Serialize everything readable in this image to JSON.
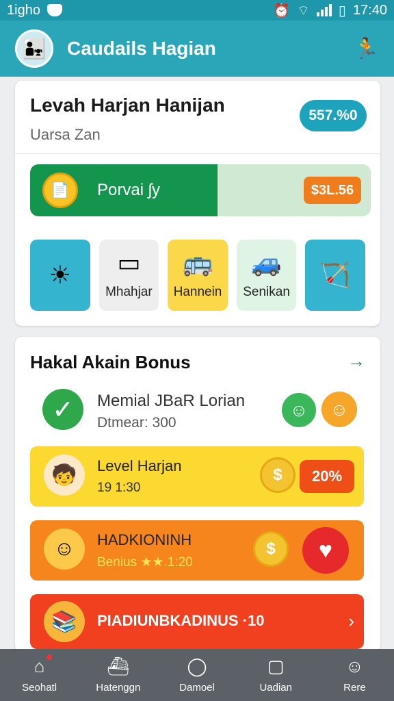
{
  "status": {
    "carrier": "1igho",
    "time": "17:40"
  },
  "header": {
    "title": "Caudails Hagian"
  },
  "level": {
    "title": "Levah Harjan Hanijan",
    "subtitle": "Uarsa Zan",
    "pill": "557.%0"
  },
  "progress": {
    "label": "Porvai ʃy",
    "price": "$3L.56",
    "fill_fraction": 0.55
  },
  "tiles": [
    {
      "icon": "sun-icon",
      "label": "",
      "bg": "#35b4cf"
    },
    {
      "icon": "tablet-icon",
      "label": "Mhahjar",
      "bg": "#eeeeee"
    },
    {
      "icon": "bus-icon",
      "label": "Hannein",
      "bg": "#fbd84a"
    },
    {
      "icon": "car-icon",
      "label": "Senikan",
      "bg": "#dff4e4"
    },
    {
      "icon": "bow-icon",
      "label": "",
      "bg": "#35b4cf"
    }
  ],
  "bonus": {
    "title": "Hakal Akain Bonus",
    "hero_title": "Memial JBaR Lorian",
    "hero_sub": "Dtmear: 300",
    "rows": [
      {
        "title": "Level Harjan",
        "sub": "19 1:30",
        "badge": "20%"
      },
      {
        "title": "HADKIONINH",
        "sub": "Benius ★★.1:20"
      },
      {
        "title": "PIADIUNBKADINUS ·10"
      }
    ]
  },
  "tabs": [
    {
      "label": "Seohatl",
      "icon": "home-icon"
    },
    {
      "label": "Hatenggn",
      "icon": "ship-icon"
    },
    {
      "label": "Damoel",
      "icon": "chat-icon"
    },
    {
      "label": "Uadian",
      "icon": "square-icon"
    },
    {
      "label": "Rere",
      "icon": "profile-icon"
    }
  ]
}
